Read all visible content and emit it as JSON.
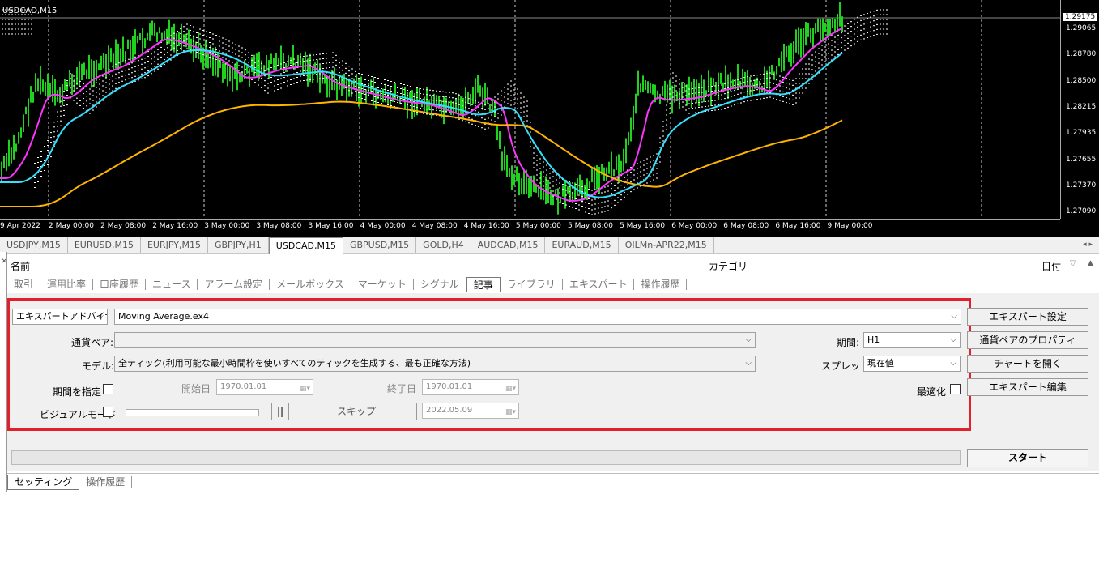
{
  "chart": {
    "title": "USDCAD,M15",
    "current_price": "1.29175",
    "price_labels": [
      "1.29065",
      "1.28780",
      "1.28500",
      "1.28215",
      "1.27935",
      "1.27655",
      "1.27370",
      "1.27090"
    ],
    "time_labels": [
      "9 Apr 2022",
      "2 May 00:00",
      "2 May 08:00",
      "2 May 16:00",
      "3 May 00:00",
      "3 May 08:00",
      "3 May 16:00",
      "4 May 00:00",
      "4 May 08:00",
      "4 May 16:00",
      "5 May 00:00",
      "5 May 08:00",
      "5 May 16:00",
      "6 May 00:00",
      "6 May 08:00",
      "6 May 16:00",
      "9 May 00:00"
    ],
    "colors": {
      "candles": "#1ed21e",
      "ma_fast": "#ff33ff",
      "ma_mid": "#33e0ff",
      "ma_slow": "#ffb400",
      "cloud": "#ffffff"
    }
  },
  "symbol_tabs": [
    "USDJPY,M15",
    "EURUSD,M15",
    "EURJPY,M15",
    "GBPJPY,H1",
    "USDCAD,M15",
    "GBPUSD,M15",
    "GOLD,H4",
    "AUDCAD,M15",
    "EURAUD,M15",
    "OILMn-APR22,M15"
  ],
  "active_symbol_tab": "USDCAD,M15",
  "terminal": {
    "col_name": "名前",
    "col_category": "カテゴリ",
    "col_date": "日付",
    "tabs": [
      "取引",
      "運用比率",
      "口座履歴",
      "ニュース",
      "アラーム設定",
      "メールボックス",
      "マーケット",
      "シグナル",
      "記事",
      "ライブラリ",
      "エキスパート",
      "操作履歴"
    ],
    "active_tab": "記事"
  },
  "tester": {
    "type_select": "エキスパートアドバイザ",
    "expert_select": "Moving Average.ex4",
    "symbol_label": "通貨ペア:",
    "symbol_value": "",
    "model_label": "モデル:",
    "model_value": "全ティック(利用可能な最小時間枠を使いすべてのティックを生成する、最も正確な方法)",
    "use_date_label": "期間を指定",
    "from_label": "開始日",
    "from_value": "1970.01.01",
    "to_label": "終了日",
    "to_value": "1970.01.01",
    "visual_label": "ビジュアルモード",
    "pause_label": "||",
    "skip_label": "スキップ",
    "skip_date": "2022.05.09",
    "period_label": "期間:",
    "period_value": "H1",
    "spread_label": "スプレッド:",
    "spread_value": "現在値",
    "optimize_label": "最適化",
    "btn_expert_props": "エキスパート設定",
    "btn_symbol_props": "通貨ペアのプロパティ",
    "btn_open_chart": "チャートを開く",
    "btn_modify_expert": "エキスパート編集",
    "start_label": "スタート"
  },
  "bottom_tabs": [
    "セッティング",
    "操作履歴"
  ],
  "active_bottom_tab": "セッティング"
}
